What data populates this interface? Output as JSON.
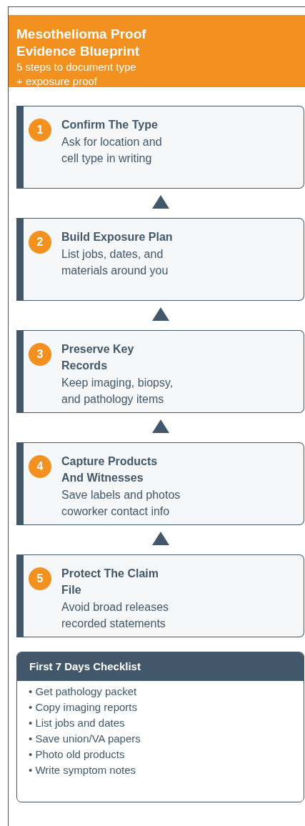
{
  "header": {
    "title": "Mesothelioma Proof Evidence Blueprint",
    "subtitle": "5 steps to document type + exposure proof"
  },
  "steps": [
    {
      "number": "1",
      "title": "Confirm The Type",
      "lines": [
        "Ask for location and",
        "cell type in writing"
      ]
    },
    {
      "number": "2",
      "title": "Build Exposure Plan",
      "lines": [
        "List jobs, dates, and",
        "materials around you"
      ]
    },
    {
      "number": "3",
      "title": "Preserve Key Records",
      "lines": [
        "Keep imaging, biopsy,",
        "and pathology items"
      ]
    },
    {
      "number": "4",
      "title": "Capture Products And Witnesses",
      "lines": [
        "Save labels and photos",
        "coworker contact info"
      ]
    },
    {
      "number": "5",
      "title": "Protect The Claim File",
      "lines": [
        "Avoid broad releases",
        "recorded statements"
      ]
    }
  ],
  "checklist": {
    "title": "First 7 Days Checklist",
    "items": [
      "• Get pathology packet",
      "• Copy imaging reports",
      "• List jobs and dates",
      "• Save union/VA papers",
      "• Photo old products",
      "• Write symptom notes"
    ]
  }
}
